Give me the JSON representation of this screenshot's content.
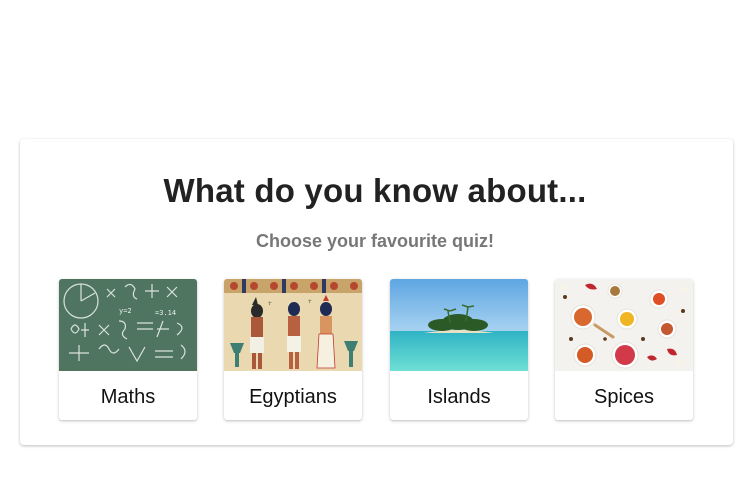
{
  "heading": "What do you know about...",
  "subheading": "Choose your favourite quiz!",
  "quizzes": [
    {
      "label": "Maths",
      "image": "chalkboard-math-image"
    },
    {
      "label": "Egyptians",
      "image": "egyptian-mural-image"
    },
    {
      "label": "Islands",
      "image": "tropical-island-image"
    },
    {
      "label": "Spices",
      "image": "spice-bowls-image"
    }
  ],
  "colors": {
    "heading": "#222222",
    "subheading": "#777777",
    "chalkboard": "#4f7560",
    "sea": "#3fc3c4",
    "sky": "#7ab8e6"
  }
}
